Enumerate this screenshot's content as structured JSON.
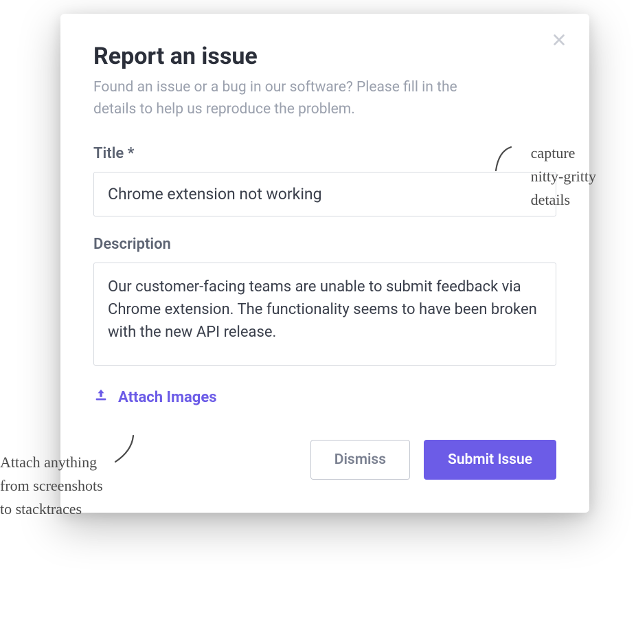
{
  "modal": {
    "title": "Report an issue",
    "subtitle": "Found an issue or a bug in our software? Please fill in the details to help us reproduce the problem.",
    "fields": {
      "title": {
        "label": "Title *",
        "value": "Chrome extension not working"
      },
      "description": {
        "label": "Description",
        "value": "Our customer-facing teams are unable to submit feedback via Chrome extension. The functionality seems to have been broken with the new API release."
      }
    },
    "attach_label": "Attach Images",
    "buttons": {
      "dismiss": "Dismiss",
      "submit": "Submit Issue"
    }
  },
  "annotations": {
    "top_right": "capture\nnitty-gritty\ndetails",
    "bottom_left": "Attach anything\nfrom screenshots\nto stacktraces"
  },
  "colors": {
    "accent": "#6c5ce7",
    "text_primary": "#2b2f3a",
    "text_muted": "#9aa0ad",
    "border": "#d7dae0"
  }
}
